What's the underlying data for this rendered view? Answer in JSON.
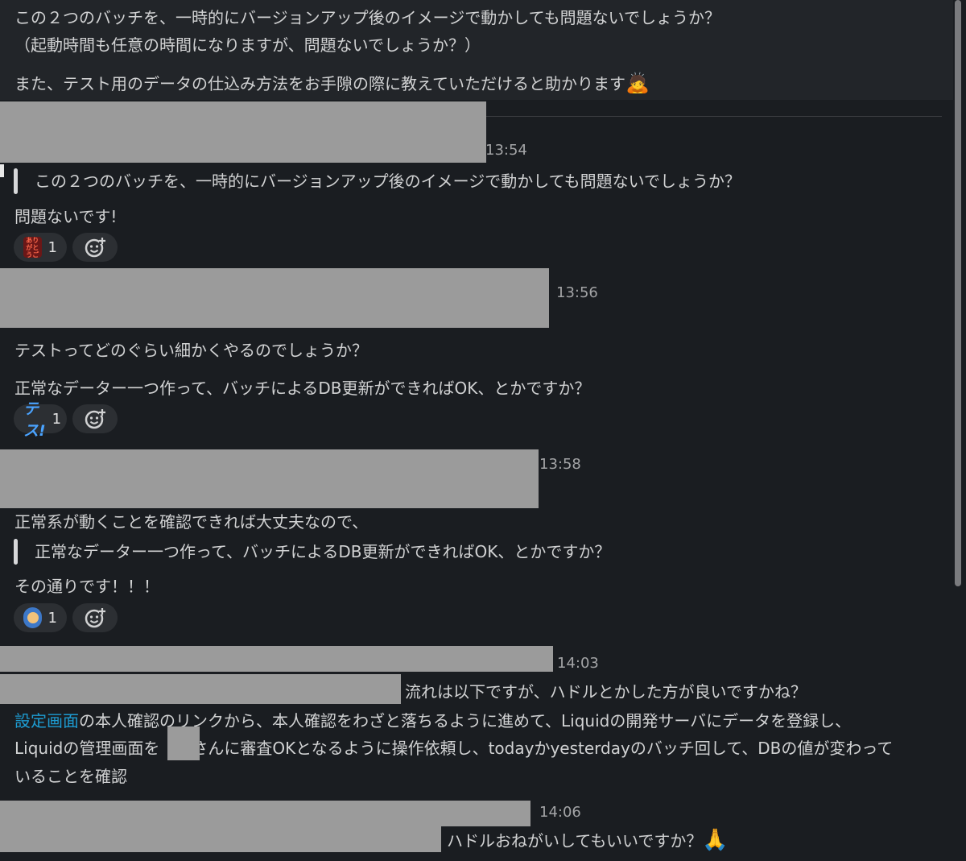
{
  "top_message": {
    "line1": "この２つのバッチを、一時的にバージョンアップ後のイメージで動かしても問題ないでしょうか？",
    "line2": "（起動時間も任意の時間になりますが、問題ないでしょうか？）",
    "line3": "また、テスト用のデータの仕込み方法をお手隙の際に教えていただけると助かります",
    "emoji": "🙇"
  },
  "messages": [
    {
      "time": "13:54",
      "quote": "この２つのバッチを、一時的にバージョンアップ後のイメージで動かしても問題ないでしょうか？",
      "text": "問題ないです!",
      "reaction": {
        "emoji_text": "ありがとうございます!",
        "count": "1"
      }
    },
    {
      "time": "13:56",
      "text1": "テストってどのぐらい細かくやるのでしょうか？",
      "text2": "正常なデーター一つ作って、バッチによるDB更新ができればOK、とかですか？",
      "reaction": {
        "emoji_text": "テス!",
        "count": "1"
      }
    },
    {
      "time": "13:58",
      "text1": "正常系が動くことを確認できれば大丈夫なので、",
      "quote": "正常なデーター一つ作って、バッチによるDB更新ができればOK、とかですか？",
      "text2": "その通りです！！！",
      "reaction": {
        "emoji_text": "",
        "count": "1"
      }
    },
    {
      "time": "14:03",
      "text1": "流れは以下ですが、ハドルとかした方が良いですかね？",
      "link": "設定画面",
      "text2": "の本人確認のリンクから、本人確認をわざと落ちるように進めて、Liquidの開発サーバにデータを登録し、",
      "text3": "Liquidの管理画面を",
      "text4": "さんに審査OKとなるように操作依頼し、todayかyesterdayのバッチ回して、DBの値が変わって",
      "text5": "いることを確認"
    },
    {
      "time": "14:06",
      "text": "ハドルおねがいしてもいいですか？",
      "emoji": "🙏"
    }
  ],
  "add_reaction_icon": "add-reaction-icon"
}
